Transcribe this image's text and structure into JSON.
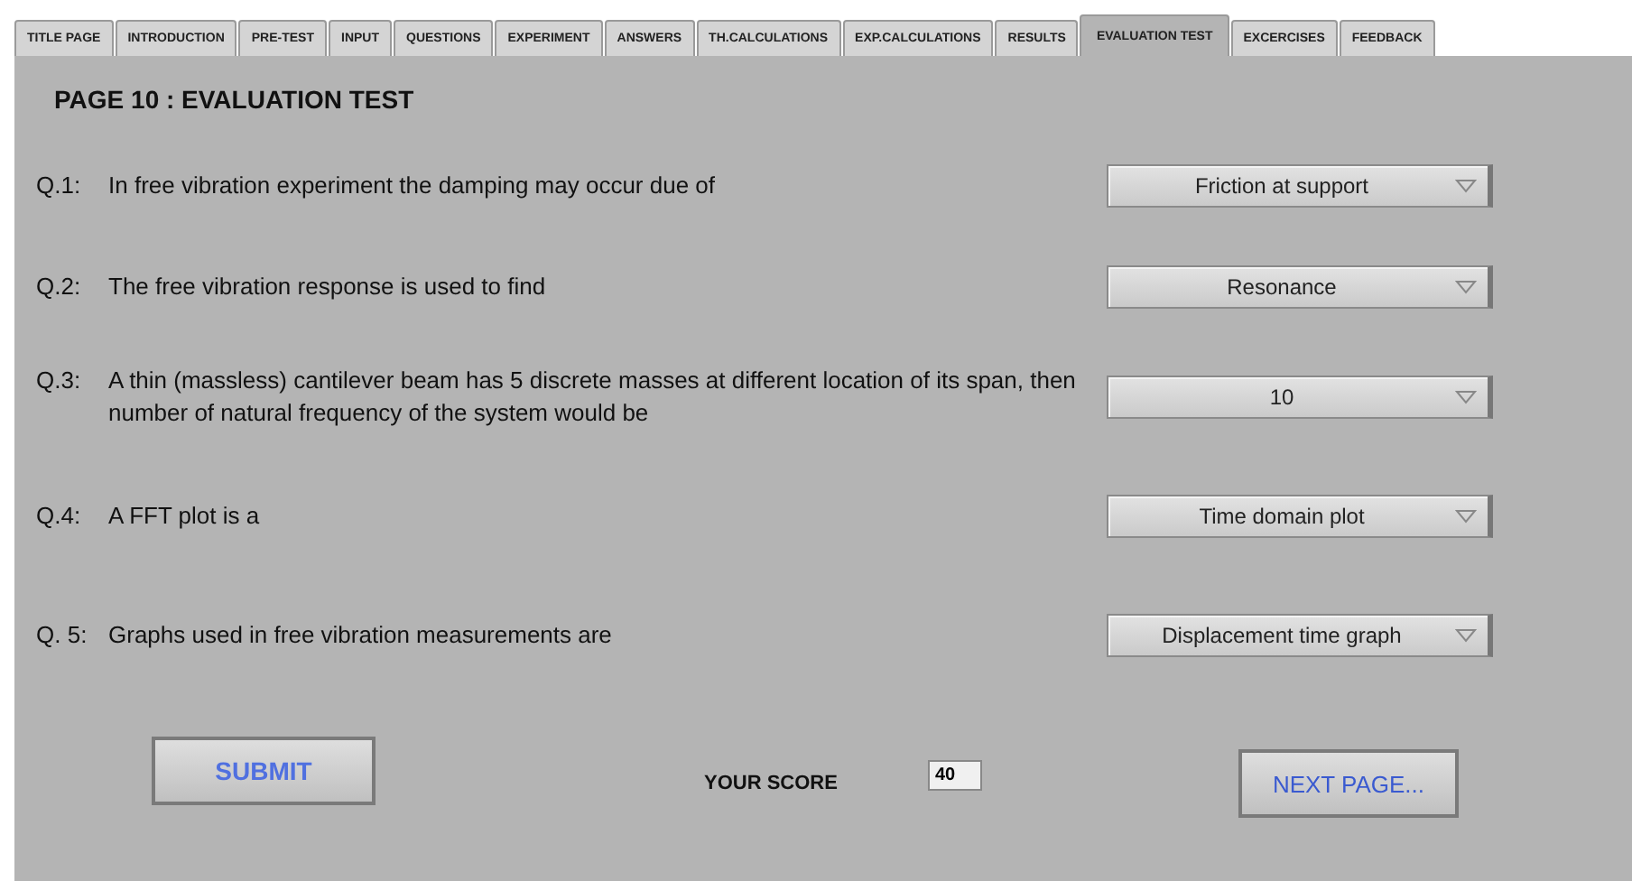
{
  "tabs": [
    {
      "label": "TITLE PAGE",
      "selected": false
    },
    {
      "label": "INTRODUCTION",
      "selected": false
    },
    {
      "label": "PRE-TEST",
      "selected": false
    },
    {
      "label": "INPUT",
      "selected": false
    },
    {
      "label": "QUESTIONS",
      "selected": false
    },
    {
      "label": "EXPERIMENT",
      "selected": false
    },
    {
      "label": "ANSWERS",
      "selected": false
    },
    {
      "label": "TH.CALCULATIONS",
      "selected": false
    },
    {
      "label": "EXP.CALCULATIONS",
      "selected": false
    },
    {
      "label": "RESULTS",
      "selected": false
    },
    {
      "label": "EVALUATION TEST",
      "selected": true
    },
    {
      "label": "EXCERCISES",
      "selected": false
    },
    {
      "label": "FEEDBACK",
      "selected": false
    }
  ],
  "page_title": "PAGE 10 :  EVALUATION TEST",
  "questions": [
    {
      "number": "Q.1:",
      "text": "In free vibration experiment the damping may occur due of",
      "answer": "Friction at support"
    },
    {
      "number": "Q.2:",
      "text": "The free vibration response is used to find",
      "answer": "Resonance"
    },
    {
      "number": "Q.3:",
      "text": "A thin (massless) cantilever beam has 5 discrete masses at different location of its span, then number of natural frequency of the system would be",
      "answer": "10"
    },
    {
      "number": "Q.4:",
      "text": "A FFT plot is a",
      "answer": "Time domain plot"
    },
    {
      "number": "Q. 5:",
      "text": "Graphs used in free vibration measurements are",
      "answer": "Displacement time graph"
    }
  ],
  "submit_button": "SUBMIT",
  "score": {
    "label": "YOUR SCORE",
    "value": "40"
  },
  "next_button": "NEXT PAGE..."
}
